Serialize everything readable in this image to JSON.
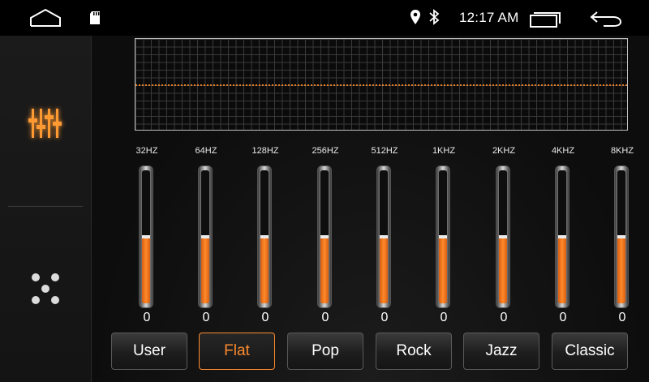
{
  "status_bar": {
    "time": "12:17 AM"
  },
  "sidebar": {
    "items": [
      {
        "name": "equalizer",
        "icon": "equalizer-sliders-icon",
        "active": true
      },
      {
        "name": "sound-field",
        "icon": "sound-field-dots-icon",
        "active": false
      }
    ]
  },
  "equalizer": {
    "bands": [
      {
        "label": "32HZ",
        "value": "0",
        "level": 0.5
      },
      {
        "label": "64HZ",
        "value": "0",
        "level": 0.5
      },
      {
        "label": "128HZ",
        "value": "0",
        "level": 0.5
      },
      {
        "label": "256HZ",
        "value": "0",
        "level": 0.5
      },
      {
        "label": "512HZ",
        "value": "0",
        "level": 0.5
      },
      {
        "label": "1KHZ",
        "value": "0",
        "level": 0.5
      },
      {
        "label": "2KHZ",
        "value": "0",
        "level": 0.5
      },
      {
        "label": "4KHZ",
        "value": "0",
        "level": 0.5
      },
      {
        "label": "8KHZ",
        "value": "0",
        "level": 0.5
      }
    ],
    "presets": [
      {
        "label": "User",
        "active": false
      },
      {
        "label": "Flat",
        "active": true
      },
      {
        "label": "Pop",
        "active": false
      },
      {
        "label": "Rock",
        "active": false
      },
      {
        "label": "Jazz",
        "active": false
      },
      {
        "label": "Classic",
        "active": false
      }
    ]
  },
  "colors": {
    "accent": "#ff8c2e",
    "background": "#000000"
  }
}
